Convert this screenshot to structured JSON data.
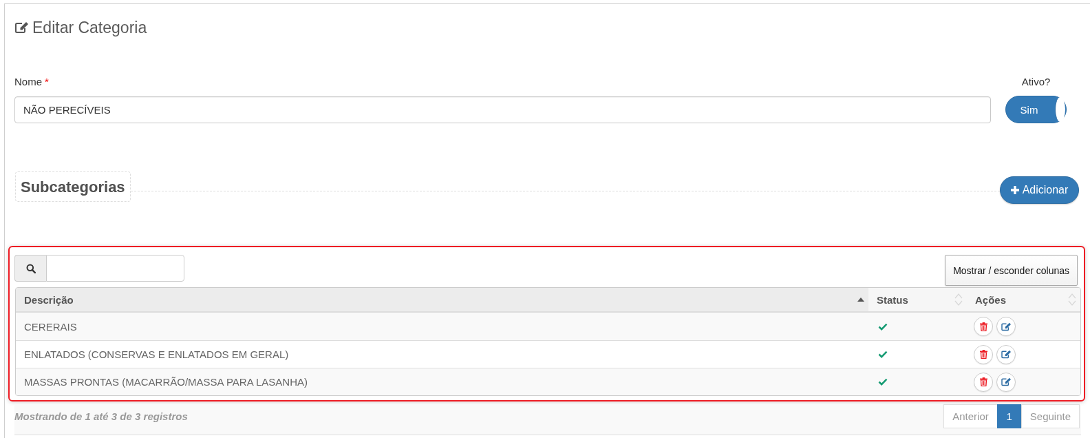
{
  "page": {
    "title": "Editar Categoria"
  },
  "form": {
    "name_field": {
      "label": "Nome",
      "required_mark": "*",
      "value": "NÃO PERECÍVEIS"
    },
    "active_toggle": {
      "label": "Ativo?",
      "text": "Sim",
      "on": true
    }
  },
  "subcategories": {
    "heading": "Subcategorias",
    "add_button": "Adicionar"
  },
  "table": {
    "columns_button": "Mostrar / esconder colunas",
    "columns": [
      {
        "label": "Descrição",
        "sorted": true
      },
      {
        "label": "Status",
        "sorted": false
      },
      {
        "label": "Ações",
        "sorted": false
      }
    ],
    "rows": [
      {
        "description": "CERERAIS",
        "active": true
      },
      {
        "description": "ENLATADOS (CONSERVAS E ENLATADOS EM GERAL)",
        "active": true
      },
      {
        "description": "MASSAS PRONTAS (MACARRÃO/MASSA PARA LASANHA)",
        "active": true
      }
    ]
  },
  "footer": {
    "info": "Mostrando de 1 até 3 de 3 registros",
    "pagination": {
      "previous": {
        "label": "Anterior",
        "disabled": true
      },
      "pages": [
        {
          "label": "1",
          "selected": true
        }
      ],
      "next": {
        "label": "Seguinte",
        "disabled": true
      }
    }
  }
}
